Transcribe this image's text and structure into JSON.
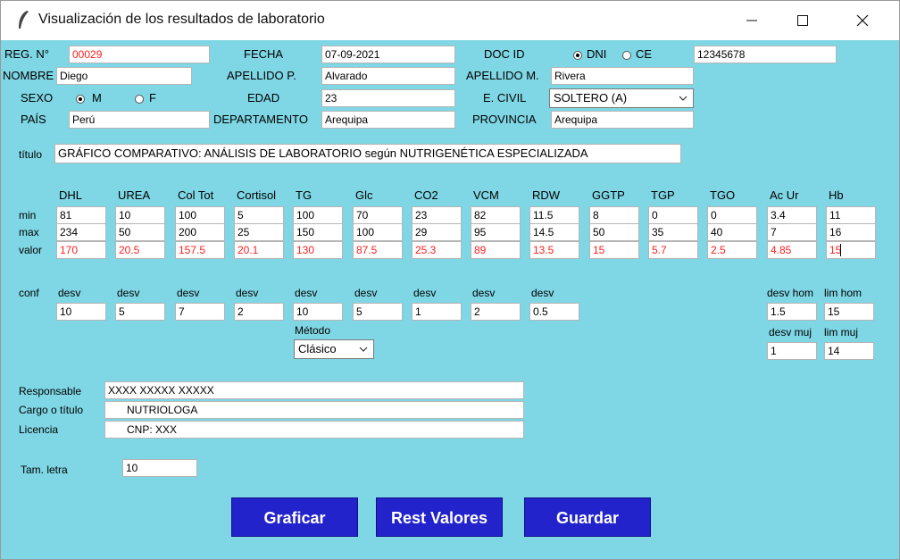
{
  "window": {
    "title": "Visualización de los resultados de laboratorio",
    "icon": "feather-icon"
  },
  "patient": {
    "reg_label": "REG. N°",
    "reg_value": "00029",
    "fecha_label": "FECHA",
    "fecha_value": "07-09-2021",
    "docid_label": "DOC ID",
    "dni_label": "DNI",
    "ce_label": "CE",
    "doc_type_selected": "DNI",
    "doc_value": "12345678",
    "nombre_label": "NOMBRE",
    "nombre_value": "Diego",
    "apellido_p_label": "APELLIDO P.",
    "apellido_p_value": "Alvarado",
    "apellido_m_label": "APELLIDO M.",
    "apellido_m_value": "Rivera",
    "sexo_label": "SEXO",
    "sexo_m": "M",
    "sexo_f": "F",
    "sexo_selected": "M",
    "edad_label": "EDAD",
    "edad_value": "23",
    "civil_label": "E. CIVIL",
    "civil_value": "SOLTERO (A)",
    "pais_label": "PAÍS",
    "pais_value": "Perú",
    "depto_label": "DEPARTAMENTO",
    "depto_value": "Arequipa",
    "provincia_label": "PROVINCIA",
    "provincia_value": "Arequipa"
  },
  "chart_title": {
    "label": "título",
    "value": "GRÁFICO COMPARATIVO: ANÁLISIS DE LABORATORIO según NUTRIGENÉTICA ESPECIALIZADA"
  },
  "lab": {
    "row_labels": {
      "min": "min",
      "max": "max",
      "valor": "valor"
    },
    "columns": [
      {
        "name": "DHL",
        "min": "81",
        "max": "234",
        "valor": "170"
      },
      {
        "name": "UREA",
        "min": "10",
        "max": "50",
        "valor": "20.5"
      },
      {
        "name": "Col Tot",
        "min": "100",
        "max": "200",
        "valor": "157.5"
      },
      {
        "name": "Cortisol",
        "min": "5",
        "max": "25",
        "valor": "20.1"
      },
      {
        "name": "TG",
        "min": "100",
        "max": "150",
        "valor": "130"
      },
      {
        "name": "Glc",
        "min": "70",
        "max": "100",
        "valor": "87.5"
      },
      {
        "name": "CO2",
        "min": "23",
        "max": "29",
        "valor": "25.3"
      },
      {
        "name": "VCM",
        "min": "82",
        "max": "95",
        "valor": "89"
      },
      {
        "name": "RDW",
        "min": "11.5",
        "max": "14.5",
        "valor": "13.5"
      },
      {
        "name": "GGTP",
        "min": "8",
        "max": "50",
        "valor": "15"
      },
      {
        "name": "TGP",
        "min": "0",
        "max": "35",
        "valor": "5.7"
      },
      {
        "name": "TGO",
        "min": "0",
        "max": "40",
        "valor": "2.5"
      },
      {
        "name": "Ac Ur",
        "min": "3.4",
        "max": "7",
        "valor": "4.85"
      },
      {
        "name": "Hb",
        "min": "11",
        "max": "16",
        "valor": "15"
      }
    ]
  },
  "conf": {
    "label": "conf",
    "desv_label": "desv",
    "desv_values": [
      "10",
      "5",
      "7",
      "2",
      "10",
      "5",
      "1",
      "2",
      "0.5"
    ],
    "metodo_label": "Método",
    "metodo_value": "Clásico",
    "desv_hom_label": "desv hom",
    "desv_hom_value": "1.5",
    "lim_hom_label": "lim hom",
    "lim_hom_value": "15",
    "desv_muj_label": "desv muj",
    "desv_muj_value": "1",
    "lim_muj_label": "lim muj",
    "lim_muj_value": "14"
  },
  "responsable": {
    "resp_label": "Responsable",
    "resp_value": "XXXX XXXXX XXXXX",
    "cargo_label": "Cargo o título",
    "cargo_value": "NUTRIOLOGA",
    "licencia_label": "Licencia",
    "licencia_value": "CNP: XXX"
  },
  "font": {
    "label": "Tam. letra",
    "value": "10"
  },
  "buttons": {
    "graficar": "Graficar",
    "rest": "Rest Valores",
    "guardar": "Guardar"
  },
  "colors": {
    "background": "#7fd6e4",
    "button": "#2323cc",
    "alert_text": "#ff2020"
  }
}
